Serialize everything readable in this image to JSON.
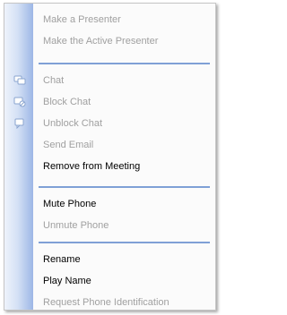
{
  "menu": {
    "items": [
      {
        "label": "Make a Presenter",
        "enabled": false
      },
      {
        "label": "Make the Active Presenter",
        "enabled": false
      },
      {
        "label": "Chat",
        "enabled": false,
        "icon": "chat-icon"
      },
      {
        "label": "Block Chat",
        "enabled": false,
        "icon": "block-chat-icon"
      },
      {
        "label": "Unblock Chat",
        "enabled": false,
        "icon": "unblock-chat-icon"
      },
      {
        "label": "Send Email",
        "enabled": false
      },
      {
        "label": "Remove from Meeting",
        "enabled": true
      },
      {
        "label": "Mute Phone",
        "enabled": true
      },
      {
        "label": "Unmute Phone",
        "enabled": false
      },
      {
        "label": "Rename",
        "enabled": true
      },
      {
        "label": "Play Name",
        "enabled": true
      },
      {
        "label": "Request Phone Identification",
        "enabled": false
      }
    ]
  },
  "colors": {
    "separator": "#7fa0d6",
    "gutter": "#9db7e6",
    "disabled_text": "#a0a0a0",
    "enabled_text": "#000000"
  }
}
